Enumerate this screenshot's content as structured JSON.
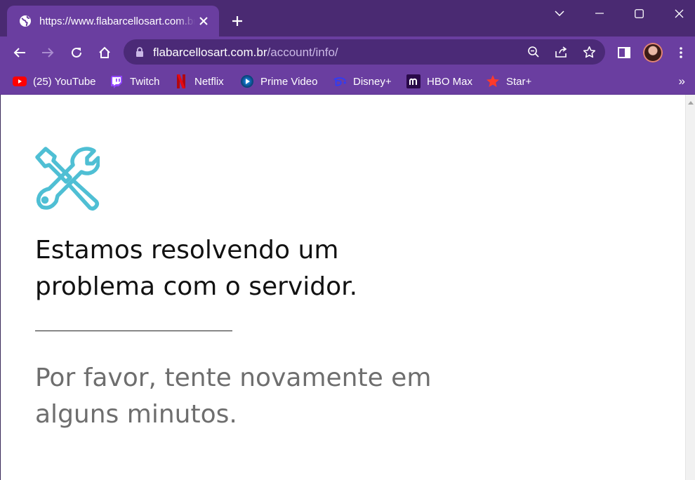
{
  "browser": {
    "tab": {
      "title": "https://www.flabarcellosart.com.br/account/info/"
    },
    "address_bar": {
      "host": "flabarcellosart.com.br",
      "path": "/account/info/"
    },
    "bookmarks": [
      {
        "label": "(25) YouTube",
        "icon": "youtube-icon"
      },
      {
        "label": "Twitch",
        "icon": "twitch-icon"
      },
      {
        "label": "Netflix",
        "icon": "netflix-icon"
      },
      {
        "label": "Prime Video",
        "icon": "prime-video-icon"
      },
      {
        "label": "Disney+",
        "icon": "disney-plus-icon"
      },
      {
        "label": "HBO Max",
        "icon": "hbo-max-icon"
      },
      {
        "label": "Star+",
        "icon": "star-plus-icon"
      }
    ],
    "bookmarks_overflow": "»",
    "theme_colors": {
      "frame": "#4a2a72",
      "toolbar": "#6a3ea0",
      "omnibox": "#4b2a77"
    }
  },
  "page": {
    "icon": "wrench-screwdriver-icon",
    "icon_color": "#4fbfd4",
    "headline": "Estamos resolvendo um problema com o servidor.",
    "subtext": "Por favor, tente novamente em alguns minutos."
  }
}
